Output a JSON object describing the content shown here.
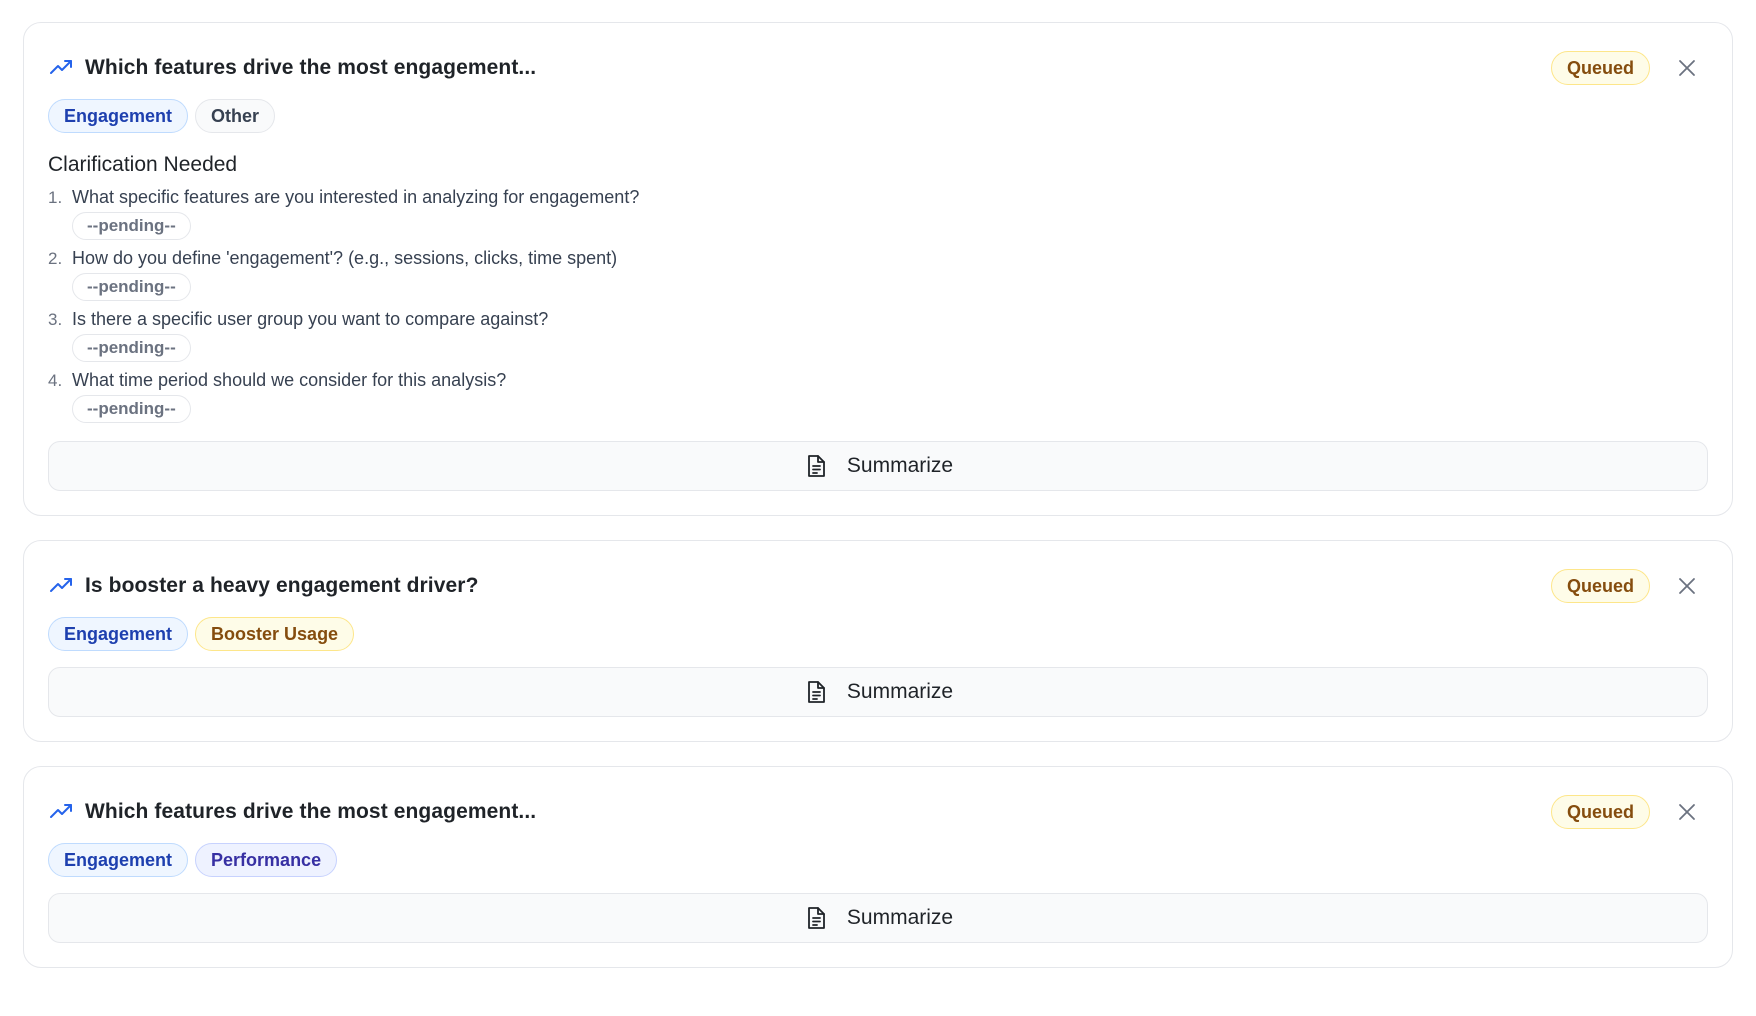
{
  "colors": {
    "accent": "#2563eb",
    "queued_bg": "#fefce8",
    "queued_text": "#854d0e"
  },
  "cards": [
    {
      "title": "Which features drive the most engagement...",
      "status": "Queued",
      "icon": "trending-up-icon",
      "tags": [
        {
          "label": "Engagement",
          "color": "blue"
        },
        {
          "label": "Other",
          "color": "gray"
        }
      ],
      "clarification": {
        "title": "Clarification Needed",
        "questions": [
          {
            "num": "1.",
            "text": "What specific features are you interested in analyzing for engagement?",
            "answer": "--pending--"
          },
          {
            "num": "2.",
            "text": "How do you define 'engagement'? (e.g., sessions, clicks, time spent)",
            "answer": "--pending--"
          },
          {
            "num": "3.",
            "text": "Is there a specific user group you want to compare against?",
            "answer": "--pending--"
          },
          {
            "num": "4.",
            "text": "What time period should we consider for this analysis?",
            "answer": "--pending--"
          }
        ]
      },
      "summarize_label": "Summarize"
    },
    {
      "title": "Is booster a heavy engagement driver?",
      "status": "Queued",
      "icon": "trending-up-icon",
      "tags": [
        {
          "label": "Engagement",
          "color": "blue"
        },
        {
          "label": "Booster Usage",
          "color": "amber"
        }
      ],
      "summarize_label": "Summarize"
    },
    {
      "title": "Which features drive the most engagement...",
      "status": "Queued",
      "icon": "trending-up-icon",
      "tags": [
        {
          "label": "Engagement",
          "color": "blue"
        },
        {
          "label": "Performance",
          "color": "indigo"
        }
      ],
      "summarize_label": "Summarize"
    }
  ]
}
